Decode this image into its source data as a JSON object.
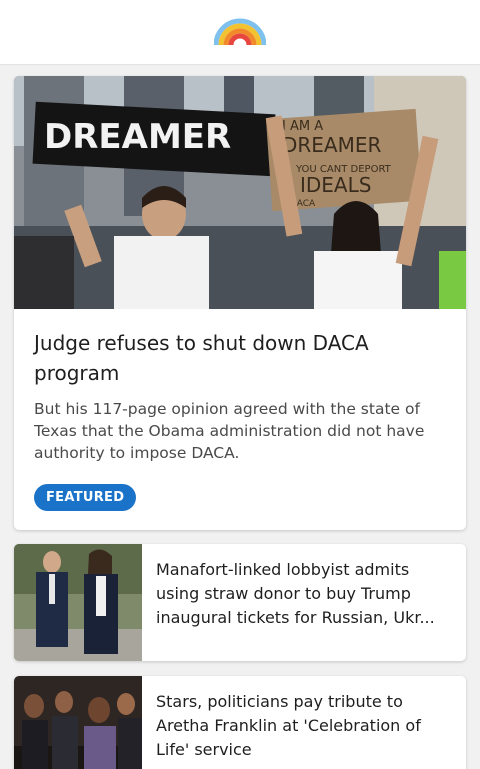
{
  "header": {
    "logo": "rainbow-logo"
  },
  "featured_story": {
    "photo_signs": [
      "DREAMER",
      "I AM A",
      "DREAMER",
      "YOU CANT DEPORT",
      "IDEALS",
      "DACA"
    ],
    "title": "Judge refuses to shut down DACA program",
    "description": "But his 117-page opinion agreed with the state of Texas that the Obama administration did not have authority to impose DACA.",
    "badge": "FEATURED"
  },
  "stories": [
    {
      "title": "Manafort-linked lobbyist admits using straw donor to buy Trump inaugural tickets for Russian, Ukr..."
    },
    {
      "title": "Stars, politicians pay tribute to Aretha Franklin at 'Celebration of Life' service"
    }
  ],
  "colors": {
    "accent": "#1a73c8",
    "background": "#f1f1f1"
  }
}
